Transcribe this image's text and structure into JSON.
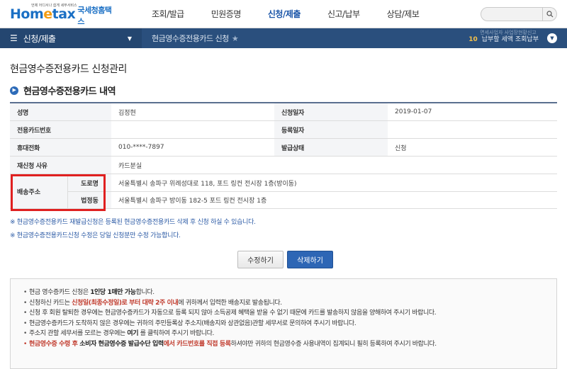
{
  "header": {
    "logo_text_1": "Hom",
    "logo_text_e": "e",
    "logo_text_2": "tax",
    "logo_tagline": "언제 어디서나 쉽게 세무서비스",
    "logo_kr": "국세청홈택스",
    "menu": [
      "조회/발급",
      "민원증명",
      "신청/제출",
      "신고/납부",
      "상담/제보"
    ],
    "active_menu": "신청/제출",
    "search_placeholder": ""
  },
  "navbar": {
    "menu_label": "신청/제출",
    "breadcrumb": "현금영수증전용카드 신청",
    "notice_number": "10",
    "notice_text": "납부할 세액 조회납부",
    "notice_ghost": "면세사업자 사업장현황신고"
  },
  "page_title": "현금영수증전용카드 신청관리",
  "section_title": "현금영수증전용카드 내역",
  "table": {
    "rows": [
      {
        "h1": "성명",
        "v1": "김정현",
        "h2": "신청일자",
        "v2": "2019-01-07"
      },
      {
        "h1": "전용카드번호",
        "v1": "",
        "h2": "등록일자",
        "v2": ""
      },
      {
        "h1": "휴대전화",
        "v1": "010-****-7897",
        "h2": "발급상태",
        "v2": "신청"
      },
      {
        "h1": "재신청 사유",
        "v1": "카드분실"
      }
    ],
    "address_label": "배송주소",
    "road_label": "도로명",
    "road_value": "서울특별시 송파구 위례성대로 118, 포드 링컨 전시장 1층(방이동)",
    "lot_label": "법정동",
    "lot_value": "서울특별시 송파구 방이동 182-5 포드 링컨 전시장 1층"
  },
  "notes": [
    "※ 현금영수증전용카드 재발급신청은 등록된 현금영수증전용카드 삭제 후 신청 하실 수 있습니다.",
    "※ 현금영수증전용카드신청 수정은 당일 신청분만 수정 가능합니다."
  ],
  "buttons": {
    "edit": "수정하기",
    "delete": "삭제하기"
  },
  "guide": {
    "l1_a": "현금 영수증카드 신청은 ",
    "l1_b": "1인당 1매만 가능",
    "l1_c": "합니다.",
    "l2_a": "신청하신 카드는 ",
    "l2_b": "신청일(최종수정일)로 부터 대략 2주 이내",
    "l2_c": "에 귀하께서 입력한 배송지로 발송됩니다.",
    "l3": "신청 후 회원 탈퇴한 경우에는 현금영수증카드가 자동으로 등록 되지 않아 소득공제 혜택을 받을 수 없기 때문에 카드를 발송하지 않음을 양해하여 주시기 바랍니다.",
    "l4": "현금영수증카드가 도착하지 않은 경우에는 귀하의 주민등록상 주소지(배송지와 상관없음)관할 세무서로 문의하여 주시기 바랍니다.",
    "l5_a": "주소지 관할 세무서를 모르는 경우에는 ",
    "l5_b": "여기",
    "l5_c": " 를 클릭하여 주시기 바랍니다.",
    "l6_a": "현금영수증 수령 후 ",
    "l6_b": "소비자 현금영수증 발급수단 입력",
    "l6_c": "에서 ",
    "l6_d": "카드번호를 직접 등록",
    "l6_e": "하셔야만 귀하의 현금영수증 사용내역이 집계되니 필히 등록하여 주시기 바랍니다."
  },
  "colors": {
    "brand_blue": "#1a6fc4",
    "navbar": "#2a4f7d",
    "highlight_red": "#e02020",
    "primary_button": "#2d66b5"
  }
}
